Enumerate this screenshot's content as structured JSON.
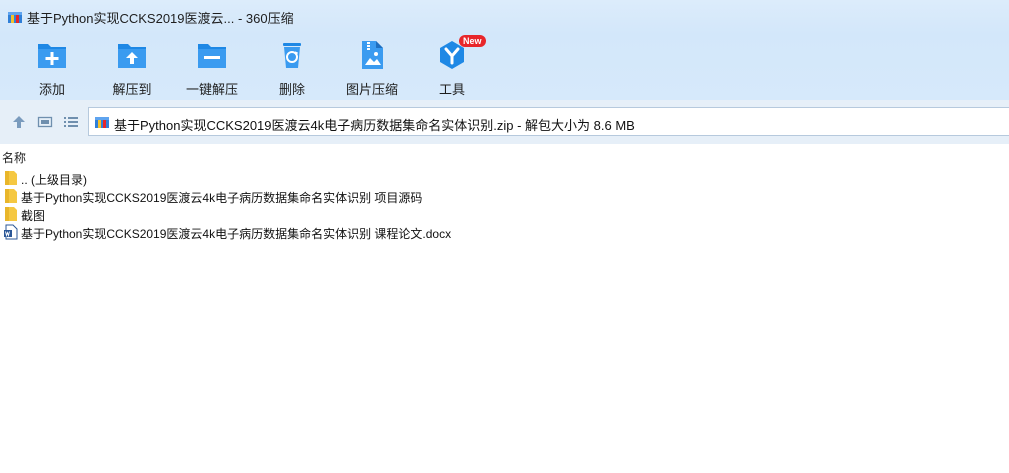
{
  "window": {
    "title": "基于Python实现CCKS2019医渡云... - 360压缩",
    "app_icon": "archive-icon"
  },
  "toolbar": {
    "items": [
      {
        "label": "添加",
        "icon": "add-icon"
      },
      {
        "label": "解压到",
        "icon": "extract-to-icon"
      },
      {
        "label": "一键解压",
        "icon": "quick-extract-icon"
      },
      {
        "label": "删除",
        "icon": "delete-icon"
      },
      {
        "label": "图片压缩",
        "icon": "image-compress-icon"
      },
      {
        "label": "工具",
        "icon": "tools-icon",
        "badge": "New"
      }
    ]
  },
  "nav": {
    "buttons": [
      "up-arrow-icon",
      "view-thumbnail-icon",
      "view-list-icon"
    ]
  },
  "address": {
    "text": "基于Python实现CCKS2019医渡云4k电子病历数据集命名实体识别.zip - 解包大小为 8.6 MB"
  },
  "list": {
    "column_name": "名称",
    "items": [
      {
        "name": ".. (上级目录)",
        "icon": "folder-icon"
      },
      {
        "name": "基于Python实现CCKS2019医渡云4k电子病历数据集命名实体识别 项目源码",
        "icon": "folder-icon"
      },
      {
        "name": "截图",
        "icon": "folder-icon"
      },
      {
        "name": "基于Python实现CCKS2019医渡云4k电子病历数据集命名实体识别 课程论文.docx",
        "icon": "word-doc-icon"
      }
    ]
  },
  "colors": {
    "toolbar_bg": "#d3e7fa",
    "icon_blue": "#1e88e5",
    "badge_red": "#e8262a",
    "folder_yellow": "#f5c842"
  }
}
